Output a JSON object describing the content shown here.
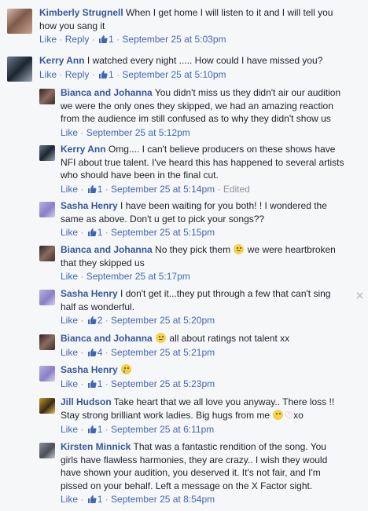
{
  "labels": {
    "like": "Like",
    "reply": "Reply",
    "sep": " · ",
    "edited": "Edited"
  },
  "comments": [
    {
      "name": "Kimberly Strugnell",
      "text": "When I get home I will listen to it and I will tell you how you sang it",
      "likes": "1",
      "time": "September 25 at 5:03pm"
    },
    {
      "name": "Kerry Ann",
      "text": "I watched every night ..... How could I have missed you?",
      "likes": "1",
      "time": "September 25 at 5:10pm"
    },
    {
      "name": "Bianca and Johanna",
      "text": "You didn't miss us they didn't air our audition we were the only ones they skipped, we had an amazing reaction from the audience im still confused as to why they didn't show us",
      "time": "September 25 at 5:12pm"
    },
    {
      "name": "Kerry Ann",
      "text": "Omg.... I can't believe producers on these shows have NFI about true talent. I've heard this has happened to several artists who should have been in the final cut.",
      "likes": "1",
      "time": "September 25 at 5:14pm",
      "edited": "Edited"
    },
    {
      "name": "Sasha Henry",
      "text": "I have been waiting for you both! ! I wondered the same as above. Don't u get to pick your songs??",
      "likes": "1",
      "time": "September 25 at 5:15pm"
    },
    {
      "name": "Bianca and Johanna",
      "text_a": "No they pick them",
      "text_b": "we were heartbroken that they skipped us",
      "time": "September 25 at 5:17pm"
    },
    {
      "name": "Sasha Henry",
      "text": "I don't get it...they put through a few that can't sing half as wonderful.",
      "likes": "2",
      "time": "September 25 at 5:20pm"
    },
    {
      "name": "Bianca and Johanna",
      "text": "all about ratings not talent xx",
      "likes": "4",
      "time": "September 25 at 5:21pm"
    },
    {
      "name": "Sasha Henry",
      "likes": "1",
      "time": "September 25 at 5:23pm"
    },
    {
      "name": "Jill Hudson",
      "text": "Take heart that we all love you anyway.. There loss !! Stay strong brilliant work ladies. Big hugs from me",
      "text_end": "xo",
      "likes": "1",
      "time": "September 25 at 6:11pm"
    },
    {
      "name": "Kirsten Minnick",
      "text": "That was a fantastic rendition of the song. You girls have flawless harmonies, they are crazy.. I wish they would have shown your audition, you deserved it. It's not fair, and I'm pissed on your behalf. Left a message on the X Factor sight.",
      "likes": "1",
      "time": "September 25 at 8:54pm"
    }
  ],
  "icons": {
    "close": "close-icon",
    "like": "thumbs-up-icon"
  },
  "colors": {
    "name": "#365899",
    "link": "#4267b2",
    "meta": "#90949c",
    "background": "#f6f7f9"
  }
}
